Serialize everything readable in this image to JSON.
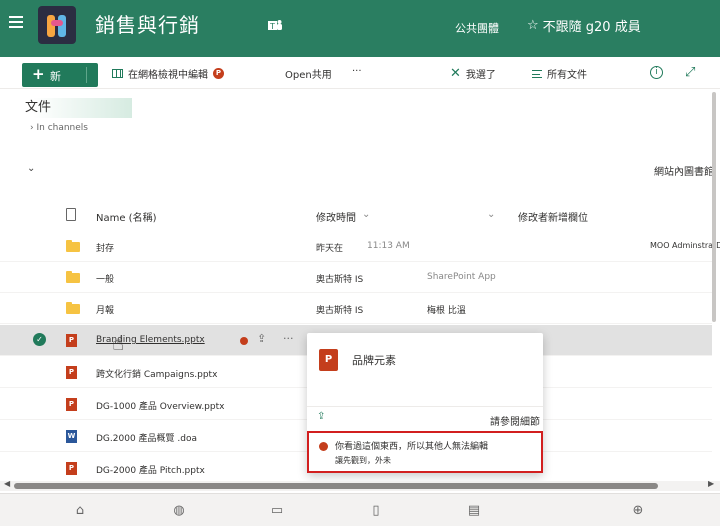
{
  "header": {
    "site_title": "銷售與行銷",
    "status": "公共團體",
    "follow_label": "不跟隨 g20 成員"
  },
  "commandbar": {
    "new_label": "新",
    "grid_edit_label": "在網格檢視中編輯",
    "open_share_label": "Open共用",
    "more_label": "···",
    "selected_label": "我選了",
    "all_docs_label": "所有文件"
  },
  "page": {
    "doc_title": "文件",
    "in_channels": "In channels",
    "site_lib_link": "網站內圖書館"
  },
  "columns": {
    "name": "Name (名稱)",
    "modified": "修改時間",
    "modified_by": "修改者新增欄位"
  },
  "rows": [
    {
      "name": "封存",
      "modified": "昨天在",
      "time": "11:13 AM",
      "extra": "MOO AdminstratDc"
    },
    {
      "name": "一般",
      "modified": "奧古斯特 IS",
      "time": "SharePoint App"
    },
    {
      "name": "月報",
      "modified": "奧古斯特 IS",
      "time": "梅根 比溫"
    },
    {
      "name": "Branding Elements.pptx"
    },
    {
      "name": "跨文化行銷 Campaigns.pptx"
    },
    {
      "name": "DG-1000 產品 Overview.pptx"
    },
    {
      "name": "DG.2000 產品概覽 .doa"
    },
    {
      "name": "DG-2000 產品 Pitch.pptx"
    }
  ],
  "popup": {
    "title": "品牌元素",
    "see_details": "請參閱細節",
    "warning": "你看過這個東西，所以其他人無法編輯",
    "warning_sub": "讓先觀到，外未"
  },
  "colors": {
    "header_bg": "#2a7e61",
    "accent": "#217a5b",
    "ppt": "#c43e1c",
    "word": "#2b579a",
    "warning_border": "#d21f1f"
  }
}
